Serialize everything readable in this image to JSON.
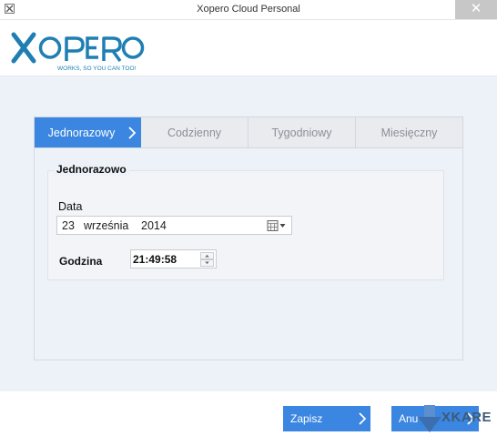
{
  "window": {
    "title": "Xopero Cloud Personal",
    "close_glyph": "✕"
  },
  "logo": {
    "name": "XOPERO",
    "tagline": "WORKS, SO YOU CAN TOO!",
    "color": "#1f7fb3"
  },
  "tabs": [
    {
      "label": "Jednorazowy",
      "active": true
    },
    {
      "label": "Codzienny",
      "active": false
    },
    {
      "label": "Tygodniowy",
      "active": false
    },
    {
      "label": "Miesięczny",
      "active": false
    }
  ],
  "schedule": {
    "group_title": "Jednorazowo",
    "date_label": "Data",
    "date": {
      "day": "23",
      "month": "września",
      "year": "2014"
    },
    "time_label": "Godzina",
    "time_value": "21:49:58"
  },
  "buttons": {
    "save_label": "Zapisz",
    "cancel_label": "Anu"
  },
  "watermark": {
    "text": "XKARE"
  },
  "colors": {
    "accent": "#3b86e0",
    "content_bg": "#edf1f8",
    "titlebar_close": "#c7c7c7"
  }
}
